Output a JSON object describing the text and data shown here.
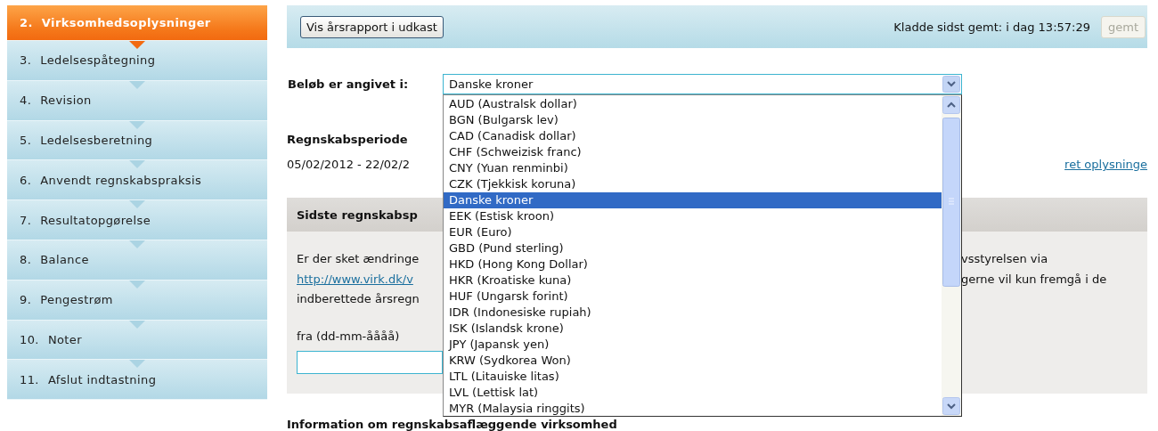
{
  "sidebar": {
    "items": [
      {
        "number": "2.",
        "label": "Virksomhedsoplysninger",
        "selected": true
      },
      {
        "number": "3.",
        "label": "Ledelsespåtegning",
        "selected": false
      },
      {
        "number": "4.",
        "label": "Revision",
        "selected": false
      },
      {
        "number": "5.",
        "label": "Ledelsesberetning",
        "selected": false
      },
      {
        "number": "6.",
        "label": "Anvendt regnskabspraksis",
        "selected": false
      },
      {
        "number": "7.",
        "label": "Resultatopgørelse",
        "selected": false
      },
      {
        "number": "8.",
        "label": "Balance",
        "selected": false
      },
      {
        "number": "9.",
        "label": "Pengestrøm",
        "selected": false
      },
      {
        "number": "10.",
        "label": "Noter",
        "selected": false
      },
      {
        "number": "11.",
        "label": "Afslut indtastning",
        "selected": false
      }
    ]
  },
  "toolbar": {
    "preview_button": "Vis årsrapport i udkast",
    "save_status": "Kladde sidst gemt: i dag 13:57:29",
    "save_button": {
      "label": "gemt",
      "disabled": true
    }
  },
  "currency": {
    "label": "Beløb er angivet i:",
    "value": "Danske kroner",
    "expanded": true,
    "options": [
      {
        "label": "AUD (Australsk dollar)",
        "selected": false
      },
      {
        "label": "BGN (Bulgarsk lev)",
        "selected": false
      },
      {
        "label": "CAD (Canadisk dollar)",
        "selected": false
      },
      {
        "label": "CHF (Schweizisk franc)",
        "selected": false
      },
      {
        "label": "CNY (Yuan renminbi)",
        "selected": false
      },
      {
        "label": "CZK (Tjekkisk koruna)",
        "selected": false
      },
      {
        "label": "Danske kroner",
        "selected": true
      },
      {
        "label": "EEK (Estisk kroon)",
        "selected": false
      },
      {
        "label": "EUR (Euro)",
        "selected": false
      },
      {
        "label": "GBD (Pund sterling)",
        "selected": false
      },
      {
        "label": "HKD (Hong Kong Dollar)",
        "selected": false
      },
      {
        "label": "HKR (Kroatiske kuna)",
        "selected": false
      },
      {
        "label": "HUF (Ungarsk forint)",
        "selected": false
      },
      {
        "label": "IDR (Indonesiske rupiah)",
        "selected": false
      },
      {
        "label": "ISK (Islandsk krone)",
        "selected": false
      },
      {
        "label": "JPY (Japansk yen)",
        "selected": false
      },
      {
        "label": "KRW (Sydkorea Won)",
        "selected": false
      },
      {
        "label": "LTL (Litauiske litas)",
        "selected": false
      },
      {
        "label": "LVL (Lettisk lat)",
        "selected": false
      },
      {
        "label": "MYR (Malaysia ringgits)",
        "selected": false
      }
    ]
  },
  "period": {
    "heading": "Regnskabsperiode",
    "dates": "05/02/2012 - 22/02/2",
    "edit_link": "ret oplysninge"
  },
  "last_period": {
    "heading": "Sidste regnskabsp",
    "lines": [
      {
        "left": "Er der sket ændringe",
        "left_link": false,
        "right": "vsstyrelsen via"
      },
      {
        "left": "http://www.virk.dk/v",
        "left_link": true,
        "right": "gerne vil kun fremgå i de"
      },
      {
        "left": "indberettede årsregn",
        "left_link": false
      }
    ],
    "from_label": "fra (dd-mm-åååå)"
  },
  "section_heading": "Information om regnskabsaflæggende virksomhed"
}
